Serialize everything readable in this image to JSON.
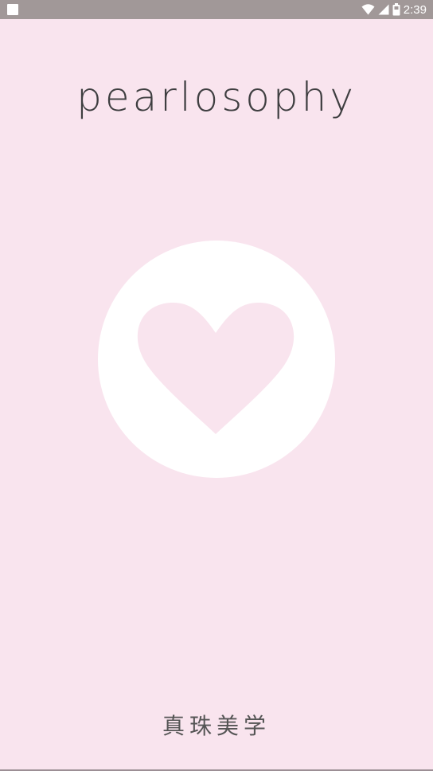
{
  "status_bar": {
    "time": "2:39",
    "icons": [
      "notification-square-icon",
      "wifi-icon",
      "cellular-signal-icon",
      "battery-icon"
    ]
  },
  "splash": {
    "brand_name": "pearlosophy",
    "logo_icon": "heart-icon",
    "tagline": "真珠美学"
  },
  "colors": {
    "background": "#f9e4ee",
    "status_bar": "#a19898",
    "heart": "#f9e4ee",
    "circle": "#ffffff",
    "text": "#3e3e40"
  }
}
